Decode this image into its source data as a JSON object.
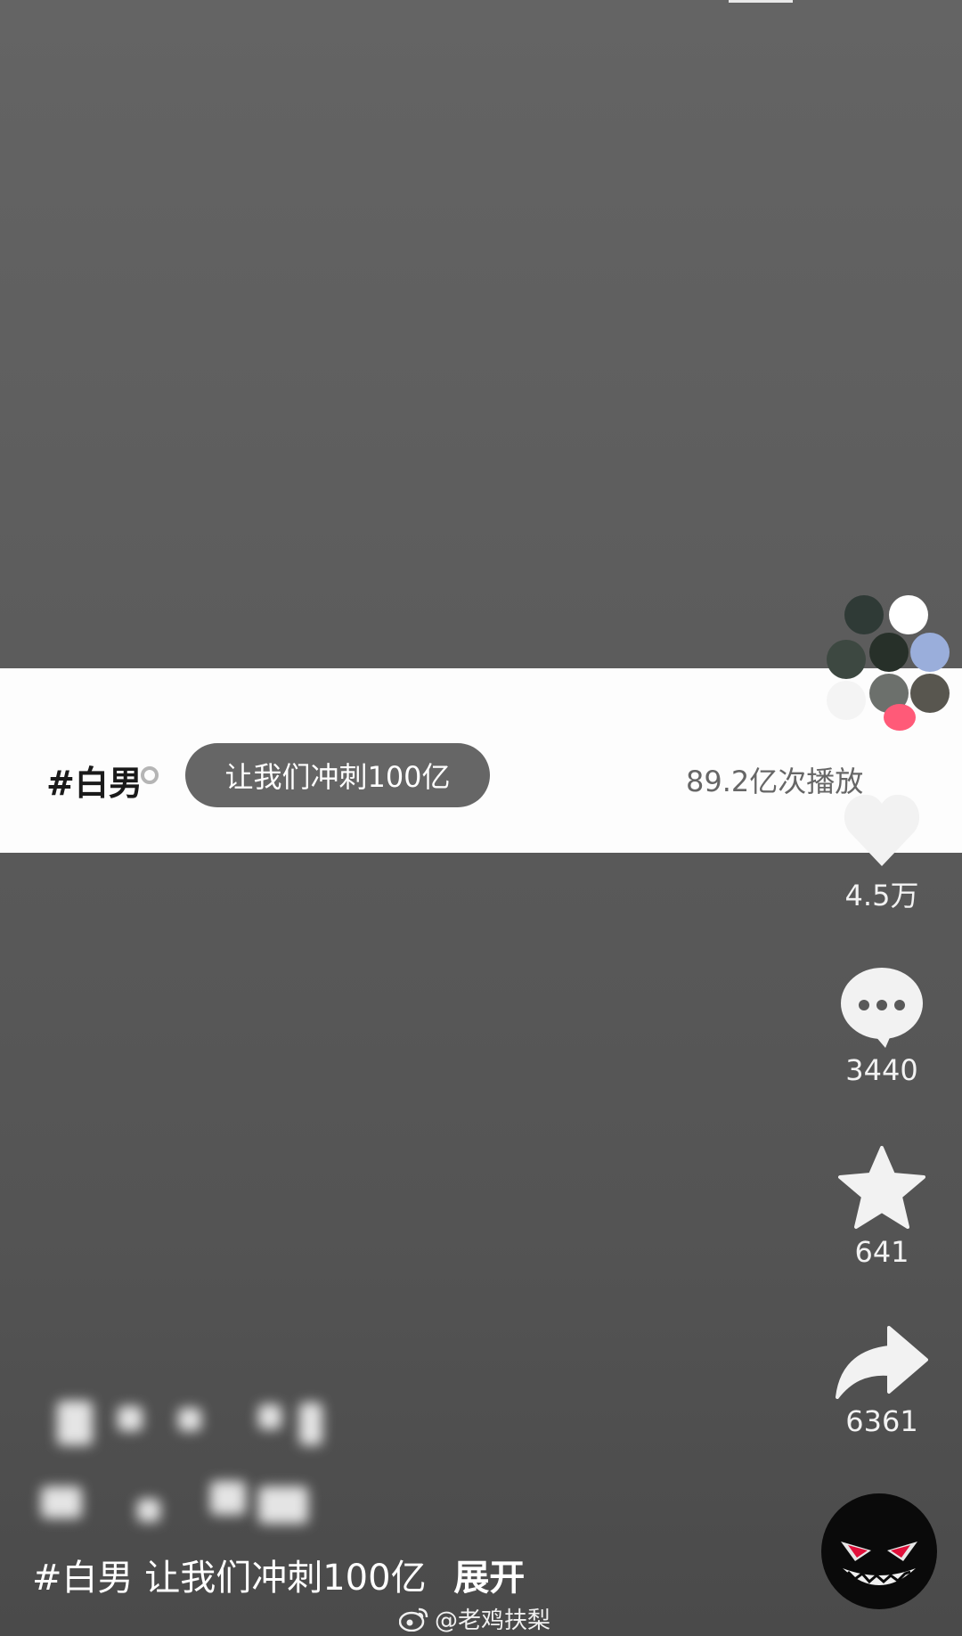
{
  "banner": {
    "topic_tag": "#白男",
    "pill_label": "让我们冲刺100亿",
    "play_count": "89.2亿次播放"
  },
  "actions": {
    "likes": "4.5万",
    "comments": "3440",
    "favorites": "641",
    "shares": "6361"
  },
  "caption": {
    "hashtag": "#白男",
    "text": "让我们冲刺100亿",
    "expand": "展开"
  },
  "watermark": "@老鸡扶梨",
  "icons": [
    "heart-icon",
    "comment-icon",
    "star-icon",
    "share-icon",
    "weibo-icon"
  ]
}
